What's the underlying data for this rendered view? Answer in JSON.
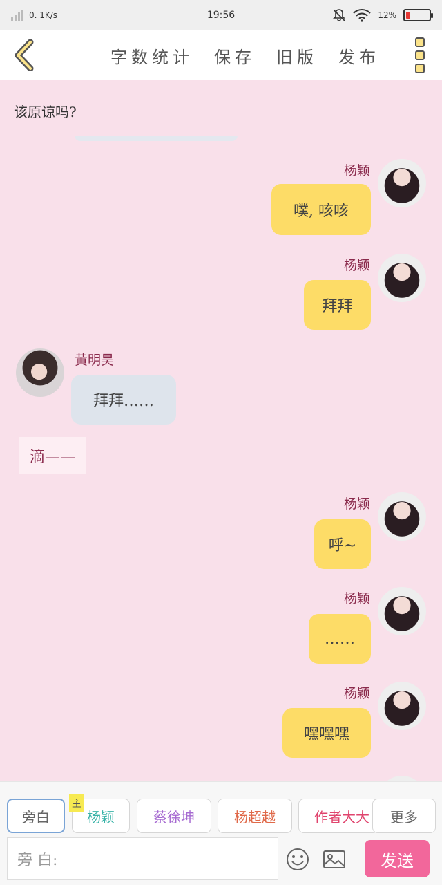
{
  "status": {
    "speed": "0. 1K/s",
    "time": "19:56",
    "battery": "12%"
  },
  "header": {
    "menu": [
      "字数统计",
      "保存",
      "旧版",
      "发布"
    ]
  },
  "chat": {
    "narration_top": "该原谅吗?",
    "messages": [
      {
        "name": "杨颖",
        "text": "噗, 咳咳"
      },
      {
        "name": "杨颖",
        "text": "拜拜"
      },
      {
        "name": "黄明昊",
        "text": "拜拜……"
      },
      {
        "name": "杨颖",
        "text": "呼~"
      },
      {
        "name": "杨颖",
        "text": "……"
      },
      {
        "name": "杨颖",
        "text": "嘿嘿嘿"
      }
    ],
    "system_text": "滴——"
  },
  "bottom": {
    "roles": [
      "旁白",
      "杨颖",
      "蔡徐坤",
      "杨超越",
      "作者大大",
      "更多"
    ],
    "main_tag": "主",
    "input_placeholder": "旁 白:",
    "send_label": "发送"
  },
  "colors": {
    "bg": "#f9e0ea",
    "my_bubble": "#fddc67",
    "other_bubble": "#dee4ec",
    "send": "#f2679b",
    "battery_low": "#e53935"
  }
}
